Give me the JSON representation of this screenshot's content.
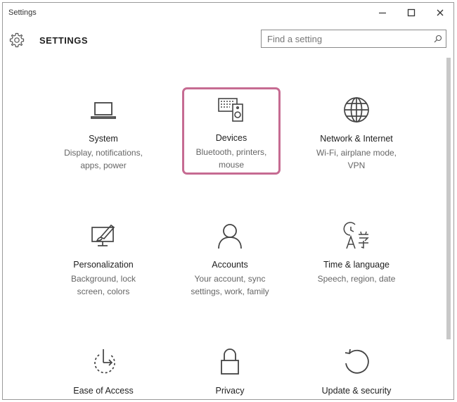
{
  "window": {
    "title": "Settings",
    "minimize_icon": "minimize-icon",
    "maximize_icon": "maximize-icon",
    "close_icon": "close-icon"
  },
  "header": {
    "icon": "gear-icon",
    "title": "SETTINGS",
    "search": {
      "value": "",
      "placeholder": "Find a setting",
      "icon": "search-icon"
    }
  },
  "colors": {
    "selection_border": "#c66b92",
    "description_text": "#666666",
    "icon_stroke": "#444444"
  },
  "categories": [
    {
      "id": "system",
      "name": "System",
      "desc_lines": [
        "Display, notifications,",
        "apps, power"
      ],
      "icon": "laptop-icon",
      "selected": false
    },
    {
      "id": "devices",
      "name": "Devices",
      "desc_lines": [
        "Bluetooth, printers,",
        "mouse"
      ],
      "icon": "devices-icon",
      "selected": true
    },
    {
      "id": "network",
      "name": "Network & Internet",
      "desc_lines": [
        "Wi-Fi, airplane mode,",
        "VPN"
      ],
      "icon": "globe-icon",
      "selected": false
    },
    {
      "id": "personalization",
      "name": "Personalization",
      "desc_lines": [
        "Background, lock",
        "screen, colors"
      ],
      "icon": "paint-monitor-icon",
      "selected": false
    },
    {
      "id": "accounts",
      "name": "Accounts",
      "desc_lines": [
        "Your account, sync",
        "settings, work, family"
      ],
      "icon": "person-icon",
      "selected": false
    },
    {
      "id": "time",
      "name": "Time & language",
      "desc_lines": [
        "Speech, region, date"
      ],
      "icon": "time-language-icon",
      "selected": false
    },
    {
      "id": "ease",
      "name": "Ease of Access",
      "desc_lines": [],
      "icon": "ease-of-access-icon",
      "selected": false
    },
    {
      "id": "privacy",
      "name": "Privacy",
      "desc_lines": [],
      "icon": "lock-icon",
      "selected": false
    },
    {
      "id": "update",
      "name": "Update & security",
      "desc_lines": [],
      "icon": "update-icon",
      "selected": false
    }
  ]
}
